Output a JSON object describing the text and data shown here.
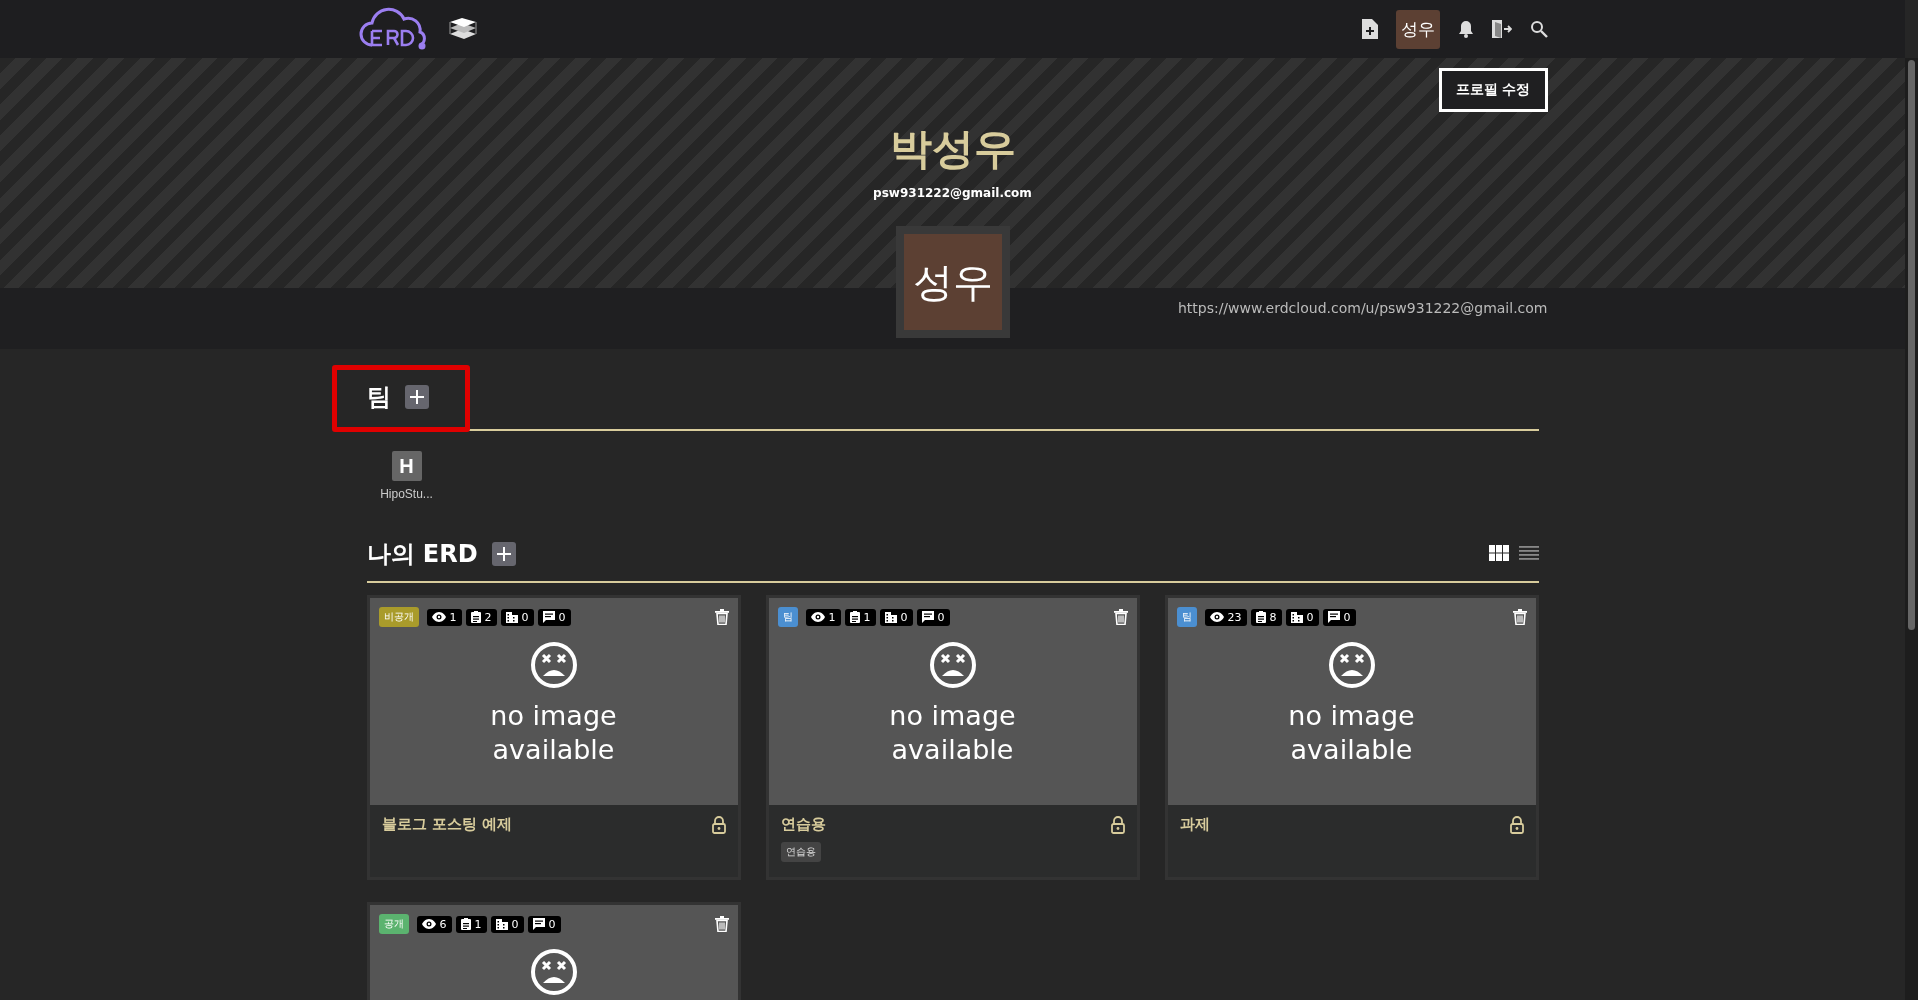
{
  "nav": {
    "avatar": "성우"
  },
  "profile": {
    "edit_button": "프로필 수정",
    "name": "박성우",
    "email": "psw931222@gmail.com",
    "avatar": "성우",
    "url": "https://www.erdcloud.com/u/psw931222@gmail.com"
  },
  "teams": {
    "title": "팀",
    "highlighted": true,
    "items": [
      {
        "initial": "H",
        "name": "HipoStu..."
      }
    ]
  },
  "my_erd": {
    "title": "나의 ERD",
    "views": [
      {
        "kind": "grid",
        "selected": true
      },
      {
        "kind": "list",
        "selected": false
      }
    ],
    "cards": [
      {
        "badge": {
          "kind": "private",
          "label": "비공개"
        },
        "stats": [
          {
            "kind": "views",
            "value": "1"
          },
          {
            "kind": "tables",
            "value": "2"
          },
          {
            "kind": "relations",
            "value": "0"
          },
          {
            "kind": "comments",
            "value": "0"
          }
        ],
        "image_text": "no image available",
        "title": "블로그 포스팅 예제"
      },
      {
        "badge": {
          "kind": "team",
          "label": "팀"
        },
        "stats": [
          {
            "kind": "views",
            "value": "1"
          },
          {
            "kind": "tables",
            "value": "1"
          },
          {
            "kind": "relations",
            "value": "0"
          },
          {
            "kind": "comments",
            "value": "0"
          }
        ],
        "image_text": "no image available",
        "title": "연습용",
        "tags": [
          "연습용"
        ]
      },
      {
        "badge": {
          "kind": "team",
          "label": "팀"
        },
        "stats": [
          {
            "kind": "views",
            "value": "23"
          },
          {
            "kind": "tables",
            "value": "8"
          },
          {
            "kind": "relations",
            "value": "0"
          },
          {
            "kind": "comments",
            "value": "0"
          }
        ],
        "image_text": "no image available",
        "title": "과제"
      },
      {
        "badge": {
          "kind": "public",
          "label": "공개"
        },
        "stats": [
          {
            "kind": "views",
            "value": "6"
          },
          {
            "kind": "tables",
            "value": "1"
          },
          {
            "kind": "relations",
            "value": "0"
          },
          {
            "kind": "comments",
            "value": "0"
          }
        ]
      }
    ]
  }
}
